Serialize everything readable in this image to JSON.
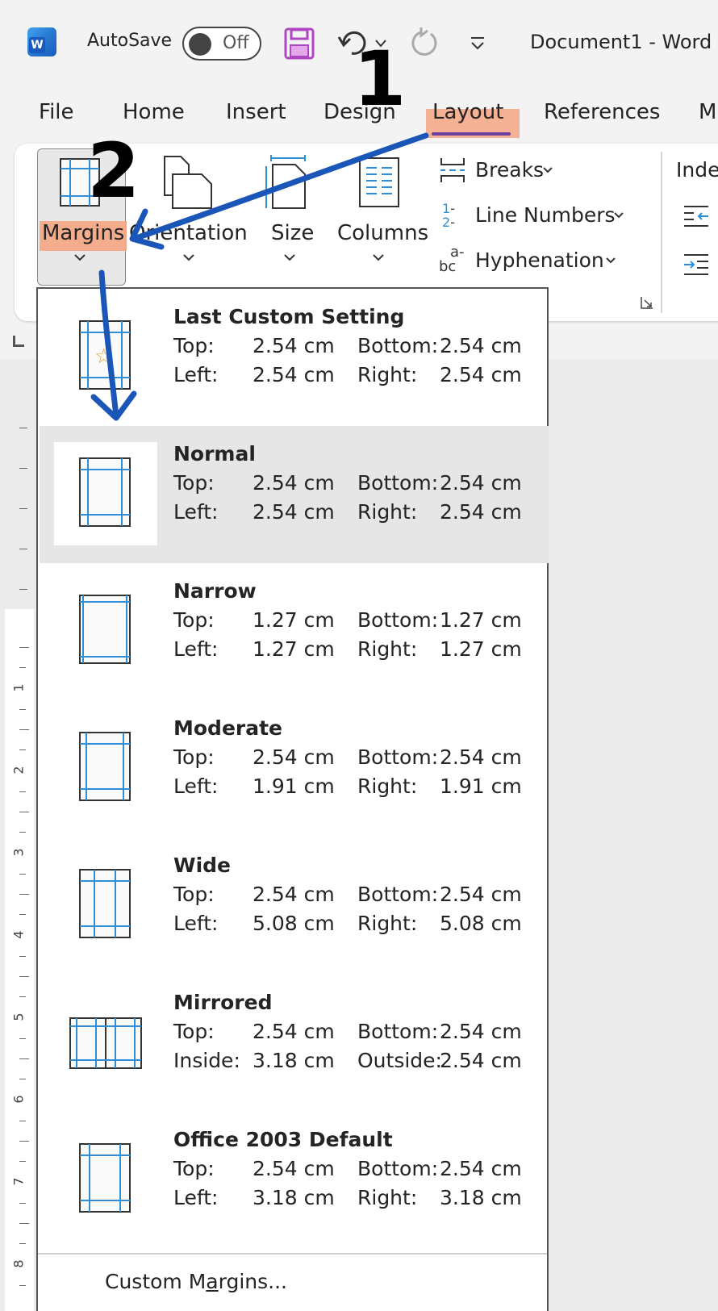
{
  "titlebar": {
    "autosave_label": "AutoSave",
    "autosave_state": "Off",
    "document_title": "Document1  -  Word",
    "icons": [
      "word-logo-icon",
      "save-icon",
      "undo-icon",
      "undo-dropdown-icon",
      "redo-icon",
      "customize-qat-icon"
    ]
  },
  "tabs": [
    {
      "label": "File"
    },
    {
      "label": "Home"
    },
    {
      "label": "Insert"
    },
    {
      "label": "Design"
    },
    {
      "label": "Layout",
      "active": true
    },
    {
      "label": "References"
    },
    {
      "label": "M"
    }
  ],
  "ribbon": {
    "margins_label": "Margins",
    "orientation_label": "Orientation",
    "size_label": "Size",
    "columns_label": "Columns",
    "breaks_label": "Breaks",
    "line_numbers_label": "Line Numbers",
    "hyphenation_label": "Hyphenation",
    "indent_group_label": "Inde"
  },
  "margins_menu": {
    "items": [
      {
        "name": "Last Custom Setting",
        "r1l": "Top:",
        "r1v": "2.54 cm",
        "r1l2": "Bottom:",
        "r1v2": "2.54 cm",
        "r2l": "Left:",
        "r2v": "2.54 cm",
        "r2l2": "Right:",
        "r2v2": "2.54 cm",
        "icon": "last-custom-margins-icon"
      },
      {
        "name": "Normal",
        "r1l": "Top:",
        "r1v": "2.54 cm",
        "r1l2": "Bottom:",
        "r1v2": "2.54 cm",
        "r2l": "Left:",
        "r2v": "2.54 cm",
        "r2l2": "Right:",
        "r2v2": "2.54 cm",
        "icon": "normal-margins-icon",
        "selected": true
      },
      {
        "name": "Narrow",
        "r1l": "Top:",
        "r1v": "1.27 cm",
        "r1l2": "Bottom:",
        "r1v2": "1.27 cm",
        "r2l": "Left:",
        "r2v": "1.27 cm",
        "r2l2": "Right:",
        "r2v2": "1.27 cm",
        "icon": "narrow-margins-icon"
      },
      {
        "name": "Moderate",
        "r1l": "Top:",
        "r1v": "2.54 cm",
        "r1l2": "Bottom:",
        "r1v2": "2.54 cm",
        "r2l": "Left:",
        "r2v": "1.91 cm",
        "r2l2": "Right:",
        "r2v2": "1.91 cm",
        "icon": "moderate-margins-icon"
      },
      {
        "name": "Wide",
        "r1l": "Top:",
        "r1v": "2.54 cm",
        "r1l2": "Bottom:",
        "r1v2": "2.54 cm",
        "r2l": "Left:",
        "r2v": "5.08 cm",
        "r2l2": "Right:",
        "r2v2": "5.08 cm",
        "icon": "wide-margins-icon"
      },
      {
        "name": "Mirrored",
        "r1l": "Top:",
        "r1v": "2.54 cm",
        "r1l2": "Bottom:",
        "r1v2": "2.54 cm",
        "r2l": "Inside:",
        "r2v": "3.18 cm",
        "r2l2": "Outside:",
        "r2v2": "2.54 cm",
        "icon": "mirrored-margins-icon"
      },
      {
        "name": "Office 2003 Default",
        "r1l": "Top:",
        "r1v": "2.54 cm",
        "r1l2": "Bottom:",
        "r1v2": "2.54 cm",
        "r2l": "Left:",
        "r2v": "3.18 cm",
        "r2l2": "Right:",
        "r2v2": "3.18 cm",
        "icon": "office2003-margins-icon"
      }
    ],
    "custom_margins_pre": "Custom M",
    "custom_margins_u": "a",
    "custom_margins_post": "rgins..."
  },
  "ruler": {
    "numbers": [
      "1",
      "2",
      "3",
      "4",
      "5",
      "6",
      "7",
      "8"
    ]
  },
  "annotations": {
    "step1": "1",
    "step2": "2"
  },
  "colors": {
    "highlight": "#f4a582",
    "arrow": "#1a56b8",
    "margin_guide": "#2e8fd6",
    "save_icon": "#b146c2",
    "word_blue": "#185abd"
  }
}
